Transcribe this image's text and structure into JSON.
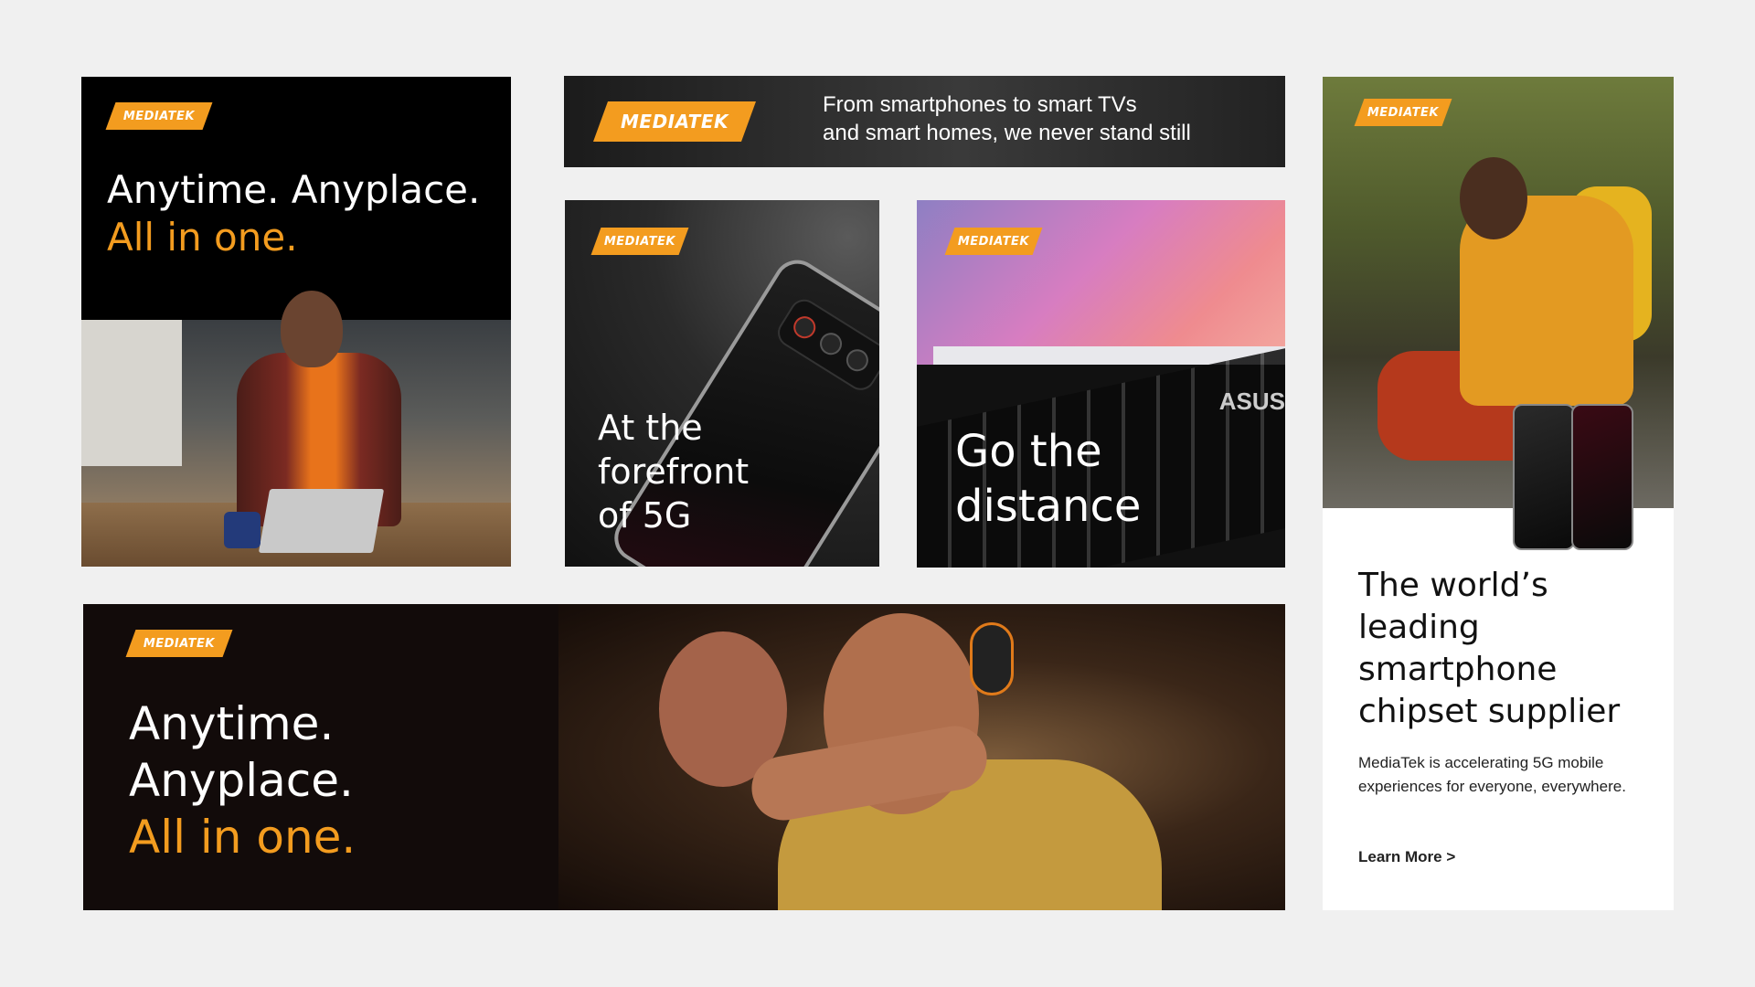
{
  "brand": {
    "logo_text": "MEDIATEK",
    "accent_color": "#f39c1f"
  },
  "card1": {
    "headline_line1": "Anytime. Anyplace.",
    "headline_line2": "All in one."
  },
  "card2": {
    "line1": "From smartphones to smart TVs",
    "line2": "and smart homes, we never stand still"
  },
  "card3": {
    "line1": "At the",
    "line2": "forefront",
    "line3": "of 5G"
  },
  "card4": {
    "line1": "Go the",
    "line2": "distance",
    "laptop_brand": "ASUS"
  },
  "card5": {
    "line1": "Anytime.",
    "line2": "Anyplace.",
    "line3": "All in one."
  },
  "card6": {
    "title_line1": "The world’s",
    "title_line2": "leading",
    "title_line3": "smartphone",
    "title_line4": "chipset supplier",
    "body": "MediaTek is accelerating 5G mobile experiences for everyone, everywhere.",
    "cta": "Learn More >"
  }
}
